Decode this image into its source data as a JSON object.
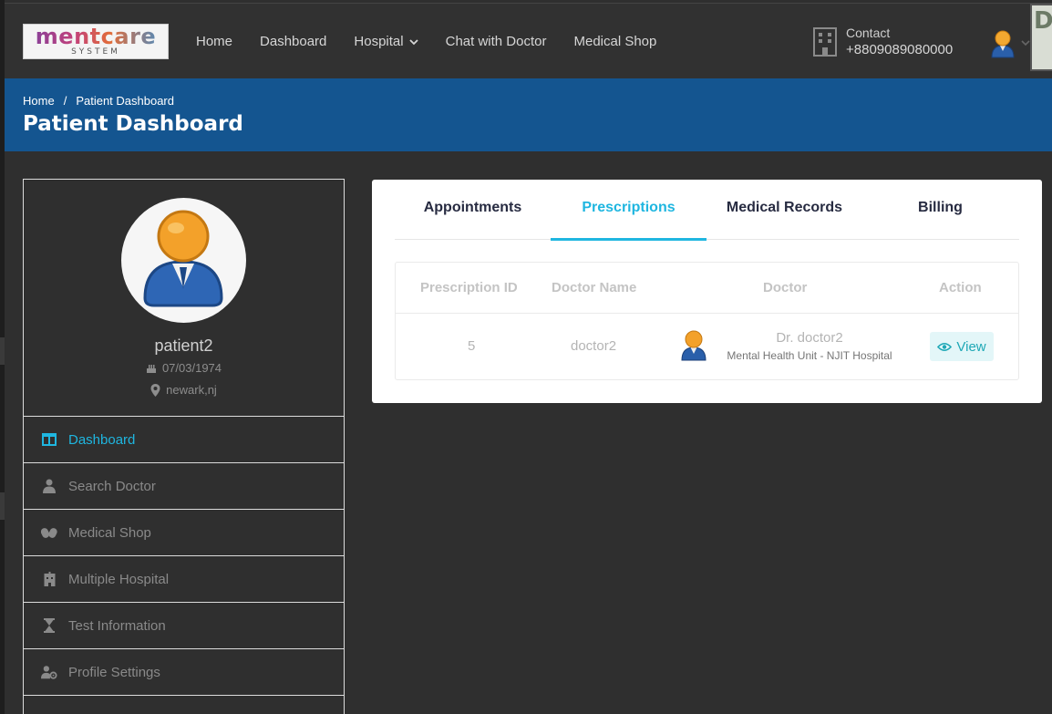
{
  "header": {
    "logo": {
      "word": "mentcare",
      "sub": "SYSTEM"
    },
    "nav": [
      {
        "label": "Home"
      },
      {
        "label": "Dashboard"
      },
      {
        "label": "Hospital"
      },
      {
        "label": "Chat with Doctor"
      },
      {
        "label": "Medical Shop"
      }
    ],
    "contact": {
      "label": "Contact",
      "phone": "+8809089080000"
    },
    "edge_badge": "DiPT"
  },
  "banner": {
    "breadcrumb": [
      "Home",
      "Patient Dashboard"
    ],
    "breadcrumb_sep": "/",
    "title": "Patient Dashboard"
  },
  "profile": {
    "name": "patient2",
    "dob": "07/03/1974",
    "location": "newark,nj"
  },
  "sidebar": {
    "items": [
      {
        "label": "Dashboard",
        "icon": "columns-icon",
        "active": true
      },
      {
        "label": "Search Doctor",
        "icon": "user-md-icon"
      },
      {
        "label": "Medical Shop",
        "icon": "capsules-icon"
      },
      {
        "label": "Multiple Hospital",
        "icon": "hospital-icon"
      },
      {
        "label": "Test Information",
        "icon": "hourglass-icon"
      },
      {
        "label": "Profile Settings",
        "icon": "user-cog-icon"
      }
    ]
  },
  "tabs": [
    {
      "label": "Appointments"
    },
    {
      "label": "Prescriptions",
      "active": true
    },
    {
      "label": "Medical Records"
    },
    {
      "label": "Billing"
    }
  ],
  "table": {
    "headers": [
      "Prescription ID",
      "Doctor Name",
      "Doctor",
      "Action"
    ],
    "rows": [
      {
        "id": "5",
        "doctor_name": "doctor2",
        "doctor_display": "Dr. doctor2",
        "department": "Mental Health Unit - NJIT Hospital",
        "action": "View"
      }
    ]
  },
  "colors": {
    "accent": "#1fb6e0",
    "banner": "#145590",
    "background": "#2f2f2f",
    "view_button_bg": "#e3f6f8",
    "view_button_text": "#1ea8b6"
  }
}
